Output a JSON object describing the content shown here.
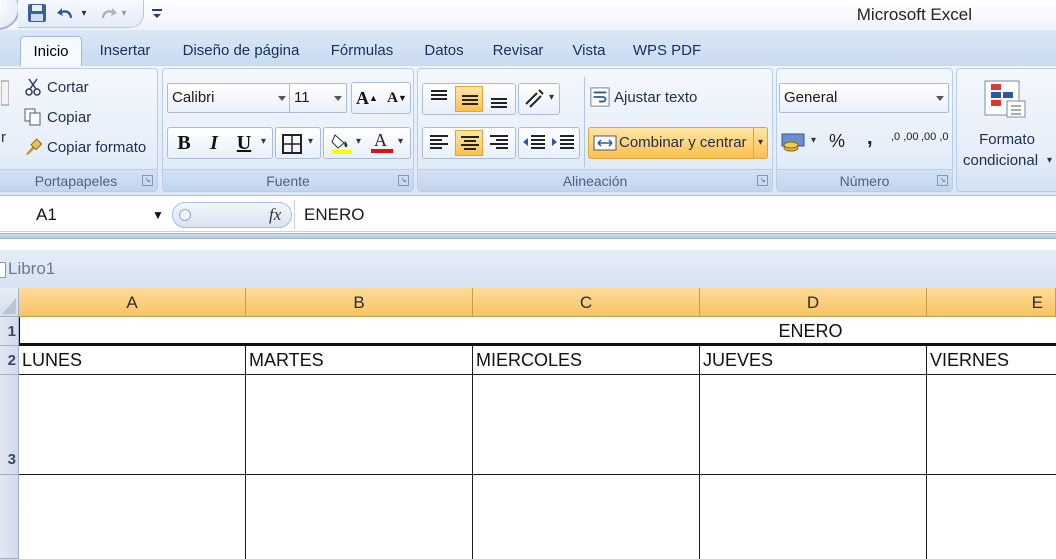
{
  "window": {
    "title": "Microsoft Excel"
  },
  "quick_access": {
    "items": [
      "save-icon",
      "undo-icon",
      "redo-icon",
      "customize-icon"
    ]
  },
  "tabs": [
    {
      "label": "Inicio",
      "active": true
    },
    {
      "label": "Insertar"
    },
    {
      "label": "Diseño de página"
    },
    {
      "label": "Fórmulas"
    },
    {
      "label": "Datos"
    },
    {
      "label": "Revisar"
    },
    {
      "label": "Vista"
    },
    {
      "label": "WPS PDF"
    }
  ],
  "ribbon": {
    "clipboard": {
      "paste_label": "r",
      "cut": "Cortar",
      "copy": "Copiar",
      "format_painter": "Copiar formato",
      "group": "Portapapeles"
    },
    "font": {
      "family": "Calibri",
      "size": "11",
      "bold": "B",
      "italic": "I",
      "underline": "U",
      "group": "Fuente",
      "fill_color": "#ffff00",
      "font_color": "#ff0000"
    },
    "alignment": {
      "wrap": "Ajustar texto",
      "merge": "Combinar y centrar",
      "group": "Alineación"
    },
    "number": {
      "format": "General",
      "percent": "%",
      "comma": ",",
      "inc_dec": ",0 ,00",
      "dec_dec": ",00 ,0",
      "group": "Número"
    },
    "styles": {
      "conditional_format_line1": "Formato",
      "conditional_format_line2": "condicional"
    }
  },
  "formula_bar": {
    "name_box": "A1",
    "fx": "fx",
    "value": "ENERO"
  },
  "workbook": {
    "title": "Libro1"
  },
  "sheet": {
    "columns": [
      "A",
      "B",
      "C",
      "D",
      "E"
    ],
    "rows": [
      "1",
      "2",
      "3"
    ],
    "merged_title": "ENERO",
    "days": [
      "LUNES",
      "MARTES",
      "MIERCOLES",
      "JUEVES",
      "VIERNES"
    ]
  },
  "colors": {
    "accent_orange": "#f8c366",
    "ribbon_blue": "#dce8f6",
    "highlight": "#ffc04d"
  }
}
